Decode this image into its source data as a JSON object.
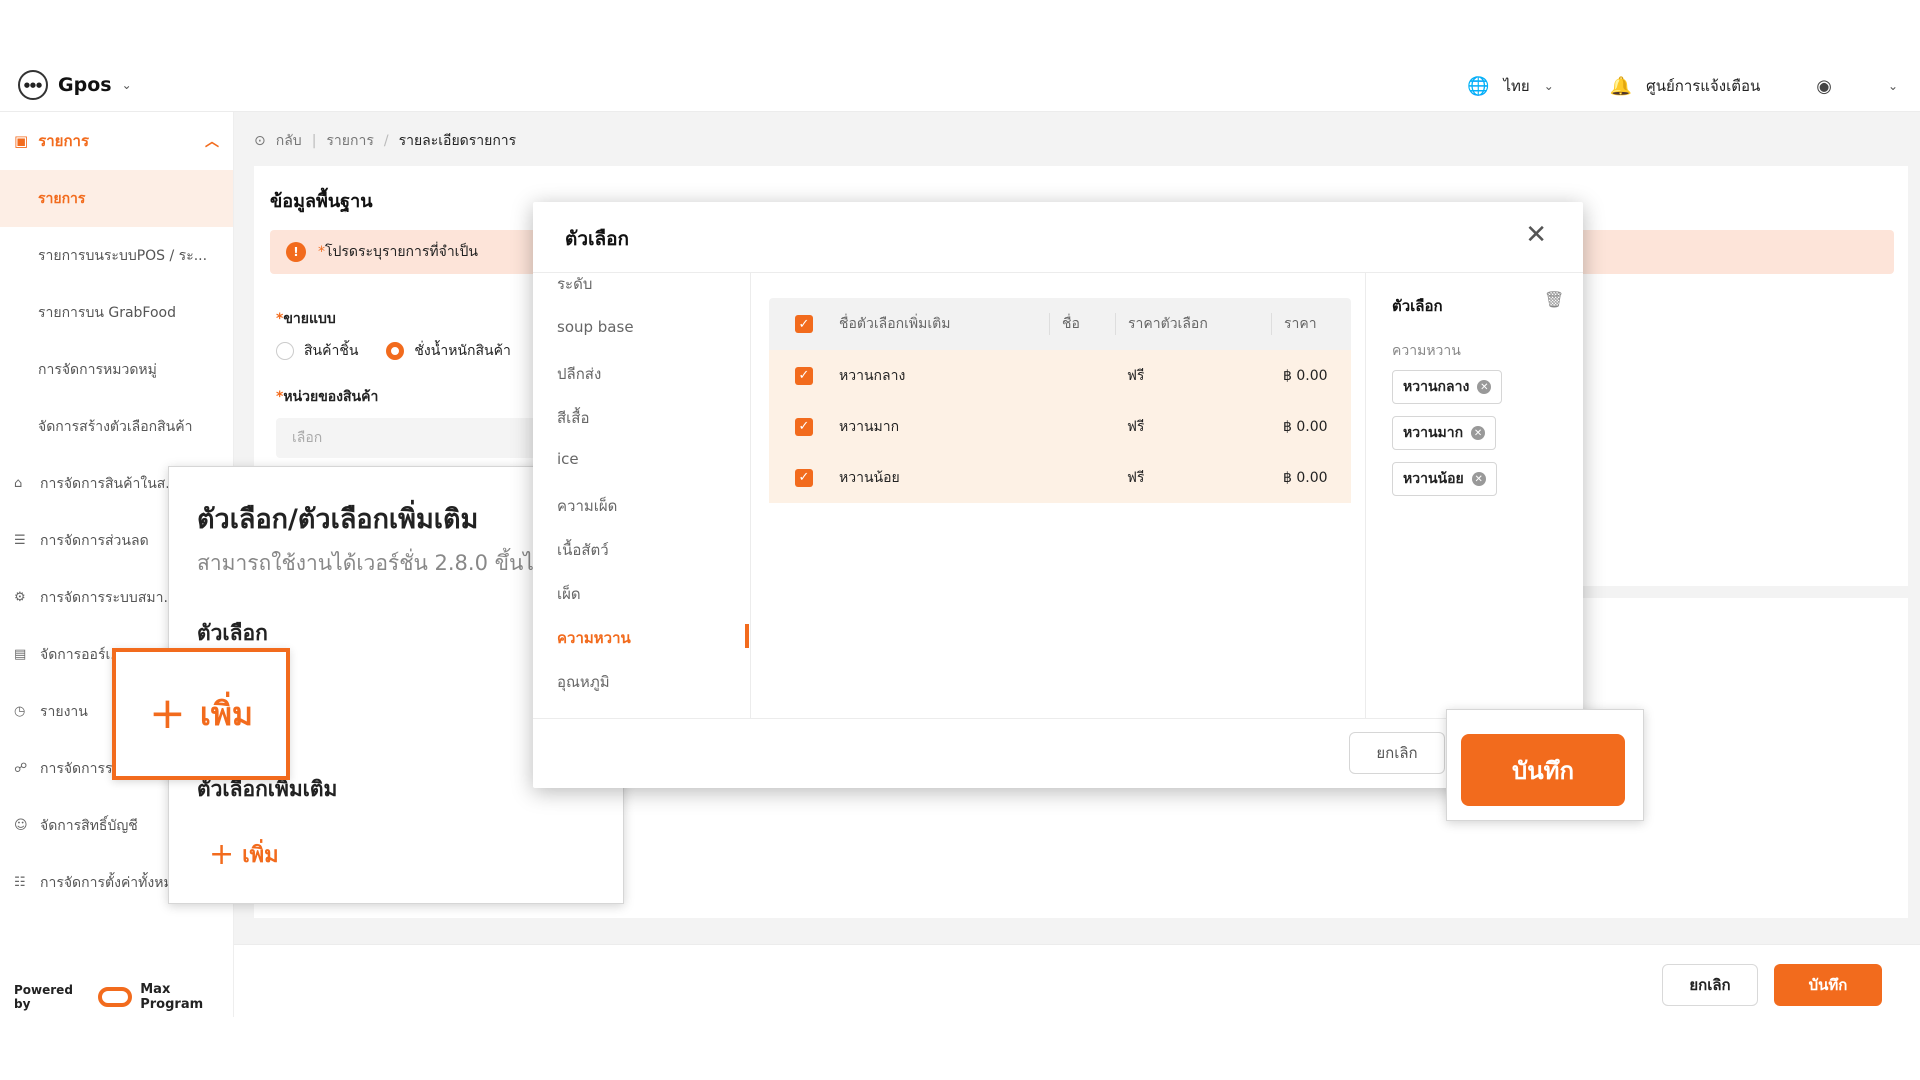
{
  "header": {
    "brand": "Gpos",
    "language": "ไทย",
    "notifications": "ศูนย์การแจ้งเตือน"
  },
  "sidebar": {
    "top_group": "รายการ",
    "sub_items": [
      {
        "label": "รายการ"
      },
      {
        "label": "รายการบนระบบPOS / ระ..."
      },
      {
        "label": "รายการบน GrabFood"
      },
      {
        "label": "การจัดการหมวดหมู่"
      },
      {
        "label": "จัดการสร้างตัวเลือกสินค้า"
      }
    ],
    "groups": [
      {
        "label": "การจัดการสินค้าในส..."
      },
      {
        "label": "การจัดการส่วนลด"
      },
      {
        "label": "การจัดการระบบสมา..."
      },
      {
        "label": "จัดการออร์เ..."
      },
      {
        "label": "รายงาน"
      },
      {
        "label": "การจัดการร..."
      },
      {
        "label": "จัดการสิทธิ์บัญชี"
      },
      {
        "label": "การจัดการตั้งค่าทั้งหม..."
      }
    ],
    "powered_by": "Powered by",
    "powered_brand": "Max Program"
  },
  "breadcrumb": {
    "back": "กลับ",
    "items": [
      "รายการ",
      "รายละเอียดรายการ"
    ],
    "sep": "/"
  },
  "form": {
    "section_title": "ข้อมูลพื้นฐาน",
    "alert": "โปรดระบุรายการที่จำเป็น",
    "sell_type_label": "ขายแบบ",
    "sell_options": [
      "สินค้าชิ้น",
      "ชั่งน้ำหนักสินค้า"
    ],
    "unit_label": "หน่วยของสินค้า",
    "unit_placeholder": "เลือก",
    "required_mark": "*"
  },
  "footer": {
    "cancel": "ยกเลิก",
    "save": "บันทึก"
  },
  "callout": {
    "title": "ตัวเลือก/ตัวเลือกเพิ่มเติม",
    "subtitle": "สามารถใช้งานได้เวอร์ชั่น 2.8.0 ขึ้นไป",
    "options_label": "ตัวเลือก",
    "add": "เพิ่ม",
    "extra_label": "ตัวเลือกเพิ่มเติม",
    "add2": "เพิ่ม"
  },
  "modal": {
    "title": "ตัวเลือก",
    "categories": [
      "ระดับ",
      "soup base",
      "ปลีกส่ง",
      "สีเสื้อ",
      "ice",
      "ความเผ็ด",
      "เนื้อสัตว์",
      "เผ็ด",
      "ความหวาน",
      "อุณหภูมิ"
    ],
    "active_category": "ความหวาน",
    "table": {
      "headers": [
        "ชื่อตัวเลือกเพิ่มเติม",
        "ชื่อ",
        "ราคาตัวเลือก",
        "ราคา"
      ],
      "rows": [
        {
          "name": "หวานกลาง",
          "short": "",
          "option_price": "ฟรี",
          "price": "฿ 0.00"
        },
        {
          "name": "หวานมาก",
          "short": "",
          "option_price": "ฟรี",
          "price": "฿ 0.00"
        },
        {
          "name": "หวานน้อย",
          "short": "",
          "option_price": "ฟรี",
          "price": "฿ 0.00"
        }
      ]
    },
    "right_panel": {
      "title": "ตัวเลือก",
      "group": "ความหวาน",
      "chips": [
        "หวานกลาง",
        "หวานมาก",
        "หวานน้อย"
      ]
    },
    "cancel": "ยกเลิก",
    "save": "บันทึก"
  },
  "icons": {
    "brand": "circle-logo-icon",
    "chevron": "chevron-down-icon",
    "globe": "globe-icon",
    "bell": "bell-icon",
    "user": "user-circle-icon",
    "close": "close-icon",
    "trash": "trash-icon",
    "check": "checkbox-checked-icon",
    "info": "info-icon"
  },
  "colors": {
    "accent": "#f26b1d",
    "alert_bg": "#fde4d9",
    "row_bg": "#fdf1e5"
  }
}
